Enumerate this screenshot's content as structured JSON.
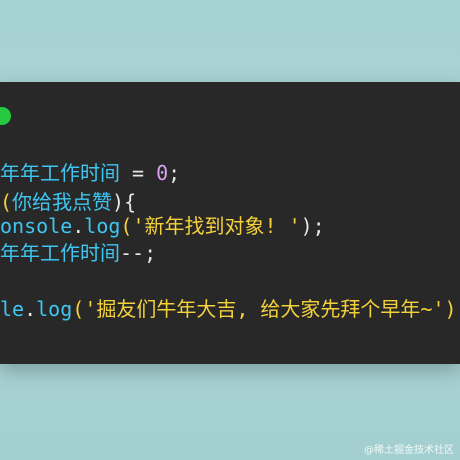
{
  "code_lines": [
    [
      {
        "text": "年年工作时间",
        "kind": "var"
      },
      {
        "text": " = ",
        "kind": "op"
      },
      {
        "text": "0",
        "kind": "num"
      },
      {
        "text": ";",
        "kind": "punc"
      }
    ],
    [
      {
        "text": "(",
        "kind": "paren"
      },
      {
        "text": "你给我点赞",
        "kind": "var"
      },
      {
        "text": "){",
        "kind": "punc"
      }
    ],
    [
      {
        "text": "onsole",
        "kind": "var"
      },
      {
        "text": ".",
        "kind": "punc"
      },
      {
        "text": "log",
        "kind": "fn"
      },
      {
        "text": "(",
        "kind": "paren"
      },
      {
        "text": "'新年找到对象! '",
        "kind": "str"
      },
      {
        "text": ");",
        "kind": "punc"
      }
    ],
    [
      {
        "text": "年年工作时间",
        "kind": "var"
      },
      {
        "text": "--;",
        "kind": "punc"
      }
    ],
    [
      {
        "text": "le",
        "kind": "var"
      },
      {
        "text": ".",
        "kind": "punc"
      },
      {
        "text": "log",
        "kind": "fn"
      },
      {
        "text": "(",
        "kind": "paren"
      },
      {
        "text": "'掘友们牛年大吉, 给大家先拜个早年~'",
        "kind": "str"
      },
      {
        "text": ")",
        "kind": "paren"
      }
    ]
  ],
  "watermark": "@稀土掘金技术社区",
  "colors": {
    "background": "#a9d3d5",
    "editor": "#282828",
    "green_dot": "#27c93f",
    "variable": "#3ec6f0",
    "string": "#f5d13a",
    "number": "#dca0f0"
  }
}
